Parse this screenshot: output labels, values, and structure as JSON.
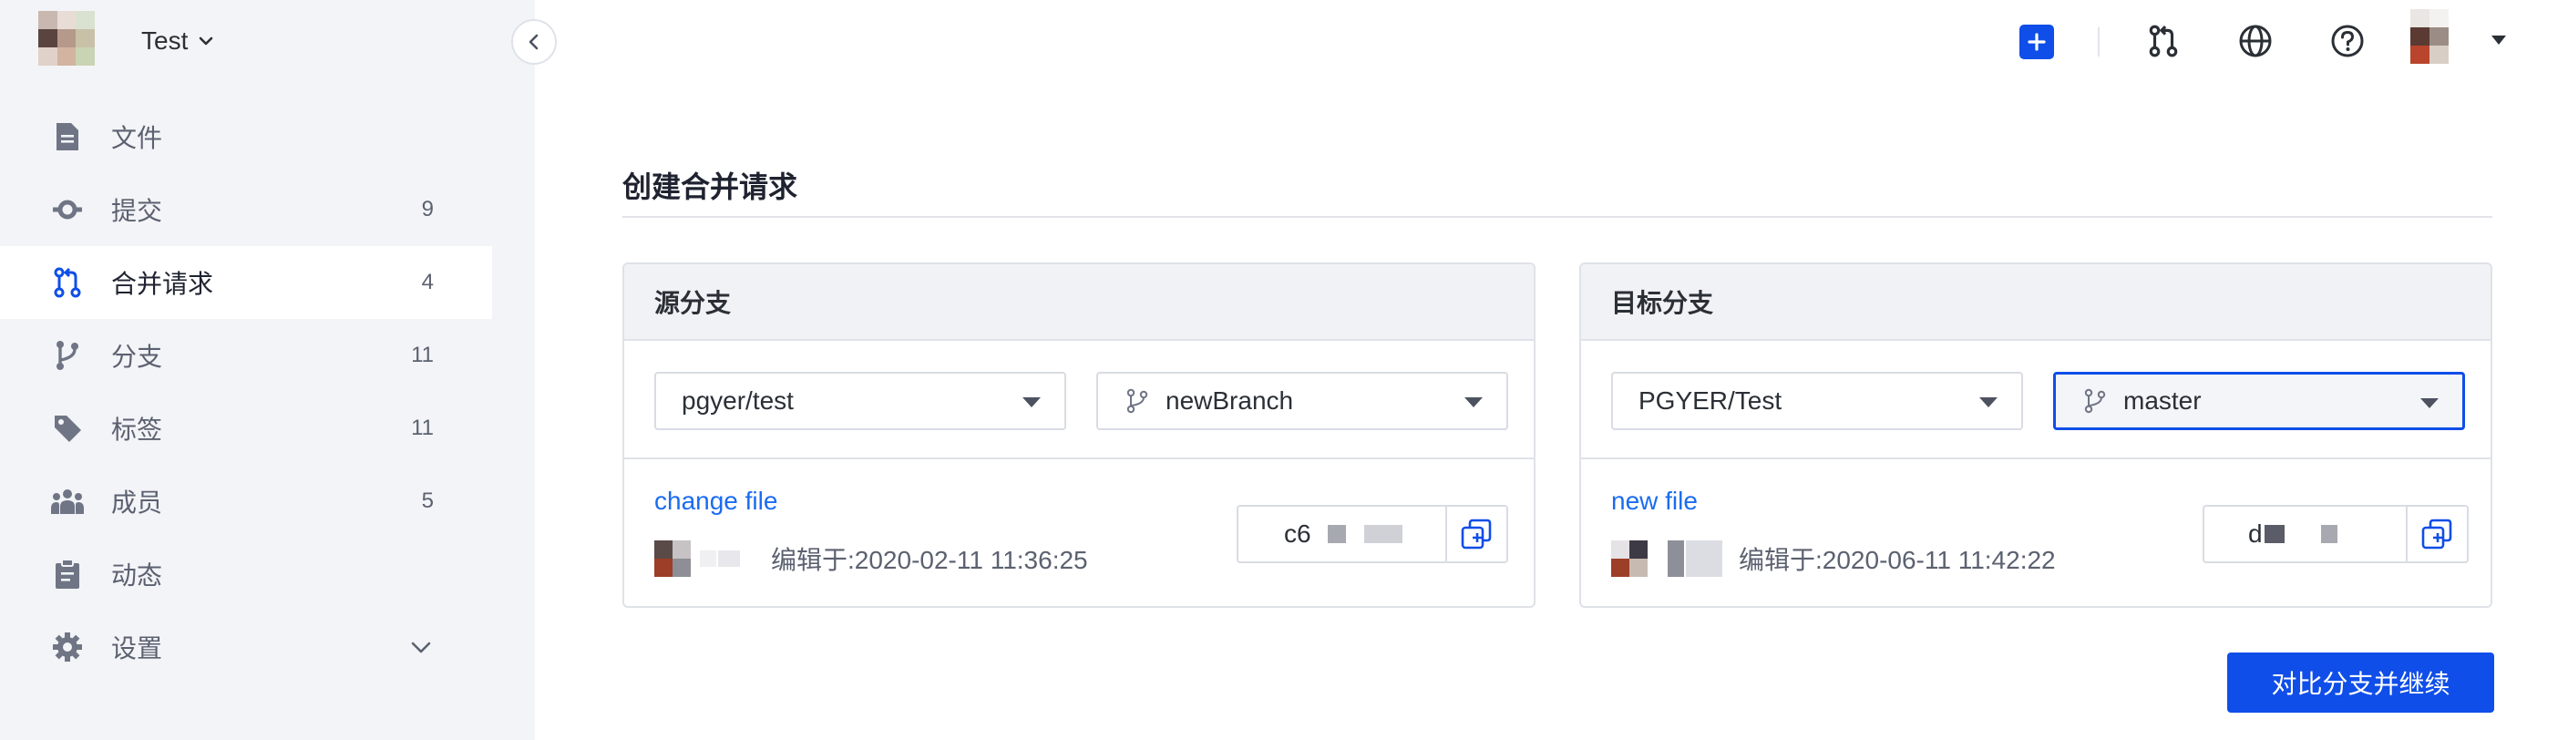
{
  "sidebar": {
    "project_name": "Test",
    "items": [
      {
        "label": "文件",
        "count": ""
      },
      {
        "label": "提交",
        "count": "9"
      },
      {
        "label": "合并请求",
        "count": "4"
      },
      {
        "label": "分支",
        "count": "11"
      },
      {
        "label": "标签",
        "count": "11"
      },
      {
        "label": "成员",
        "count": "5"
      },
      {
        "label": "动态",
        "count": ""
      },
      {
        "label": "设置",
        "count": ""
      }
    ],
    "active_item": "合并请求"
  },
  "topbar": {
    "icons": [
      "plus-icon",
      "merge-request-icon",
      "globe-icon",
      "help-icon",
      "avatar",
      "caret-down-icon"
    ]
  },
  "main": {
    "title": "创建合并请求",
    "source": {
      "heading": "源分支",
      "repo": "pgyer/test",
      "branch": "newBranch",
      "commit_message": "change file",
      "commit_date": "编辑于:2020-02-11 11:36:25",
      "sha_prefix": "c6"
    },
    "target": {
      "heading": "目标分支",
      "repo": "PGYER/Test",
      "branch": "master",
      "commit_message": "new file",
      "commit_date": "编辑于:2020-06-11 11:42:22",
      "sha_prefix": "d"
    },
    "submit_label": "对比分支并继续"
  },
  "colors": {
    "accent": "#0f4ee8",
    "link": "#1a6cf0",
    "sidebar_bg": "#f3f4f7",
    "panel_head_bg": "#f1f2f5"
  }
}
